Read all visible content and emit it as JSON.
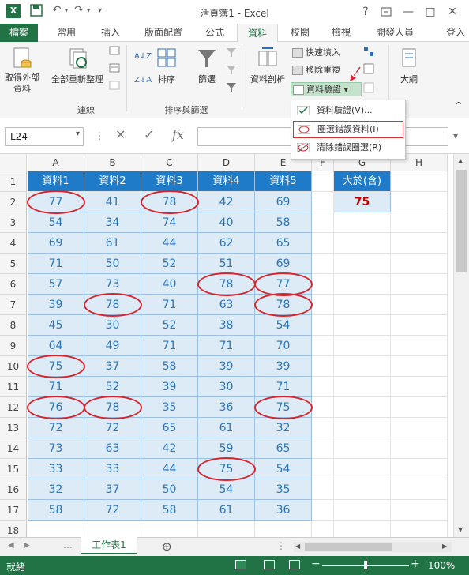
{
  "app": {
    "title": "活頁簿1 - Excel",
    "help": "?",
    "signin": "登入"
  },
  "tabs": [
    {
      "label": "檔案"
    },
    {
      "label": "常用"
    },
    {
      "label": "插入"
    },
    {
      "label": "版面配置"
    },
    {
      "label": "公式"
    },
    {
      "label": "資料"
    },
    {
      "label": "校閱"
    },
    {
      "label": "檢視"
    },
    {
      "label": "開發人員"
    }
  ],
  "ribbon": {
    "get_external": "取得外部\n資料",
    "refresh_all": "全部重新整理",
    "group_connections": "連線",
    "sort": "排序",
    "filter": "篩選",
    "group_sort_filter": "排序與篩選",
    "text_to_columns": "資料剖析",
    "flash_fill": "快速填入",
    "remove_duplicates": "移除重複",
    "data_validation": "資料驗證",
    "outline": "大綱",
    "sort_az": "A↓Z",
    "sort_za": "Z↓A"
  },
  "menu": {
    "items": [
      {
        "label": "資料驗證(V)..."
      },
      {
        "label": "圈選錯誤資料(I)"
      },
      {
        "label": "清除錯誤圈選(R)"
      }
    ]
  },
  "formula_bar": {
    "name_box": "L24",
    "fx": "fx"
  },
  "grid": {
    "columns": [
      "A",
      "B",
      "C",
      "D",
      "E",
      "F",
      "G",
      "H"
    ],
    "rows": [
      "1",
      "2",
      "3",
      "4",
      "5",
      "6",
      "7",
      "8",
      "9",
      "10",
      "11",
      "12",
      "13",
      "14",
      "15",
      "16",
      "17",
      "18"
    ],
    "headers": [
      "資料1",
      "資料2",
      "資料3",
      "資料4",
      "資料5"
    ],
    "data": [
      [
        "77",
        "41",
        "78",
        "42",
        "69"
      ],
      [
        "54",
        "34",
        "74",
        "40",
        "58"
      ],
      [
        "69",
        "61",
        "44",
        "62",
        "65"
      ],
      [
        "71",
        "50",
        "52",
        "51",
        "69"
      ],
      [
        "57",
        "73",
        "40",
        "78",
        "77"
      ],
      [
        "39",
        "78",
        "71",
        "63",
        "78"
      ],
      [
        "45",
        "30",
        "52",
        "38",
        "54"
      ],
      [
        "64",
        "49",
        "71",
        "71",
        "70"
      ],
      [
        "75",
        "37",
        "58",
        "39",
        "39"
      ],
      [
        "71",
        "52",
        "39",
        "30",
        "71"
      ],
      [
        "76",
        "78",
        "35",
        "36",
        "75"
      ],
      [
        "72",
        "72",
        "65",
        "61",
        "32"
      ],
      [
        "73",
        "63",
        "42",
        "59",
        "65"
      ],
      [
        "33",
        "33",
        "44",
        "75",
        "54"
      ],
      [
        "32",
        "37",
        "50",
        "54",
        "35"
      ],
      [
        "58",
        "72",
        "58",
        "61",
        "36"
      ]
    ],
    "criteria_label": "大於(含)",
    "criteria_value": "75"
  },
  "sheet_tab": "工作表1",
  "status": {
    "ready": "就緒",
    "zoom": "100%"
  },
  "colors": {
    "accent": "#217346",
    "header_fill": "#1f7bc7",
    "data_fill": "#ddebf7",
    "circle": "#d9242b",
    "criteria_value": "#c00000"
  }
}
